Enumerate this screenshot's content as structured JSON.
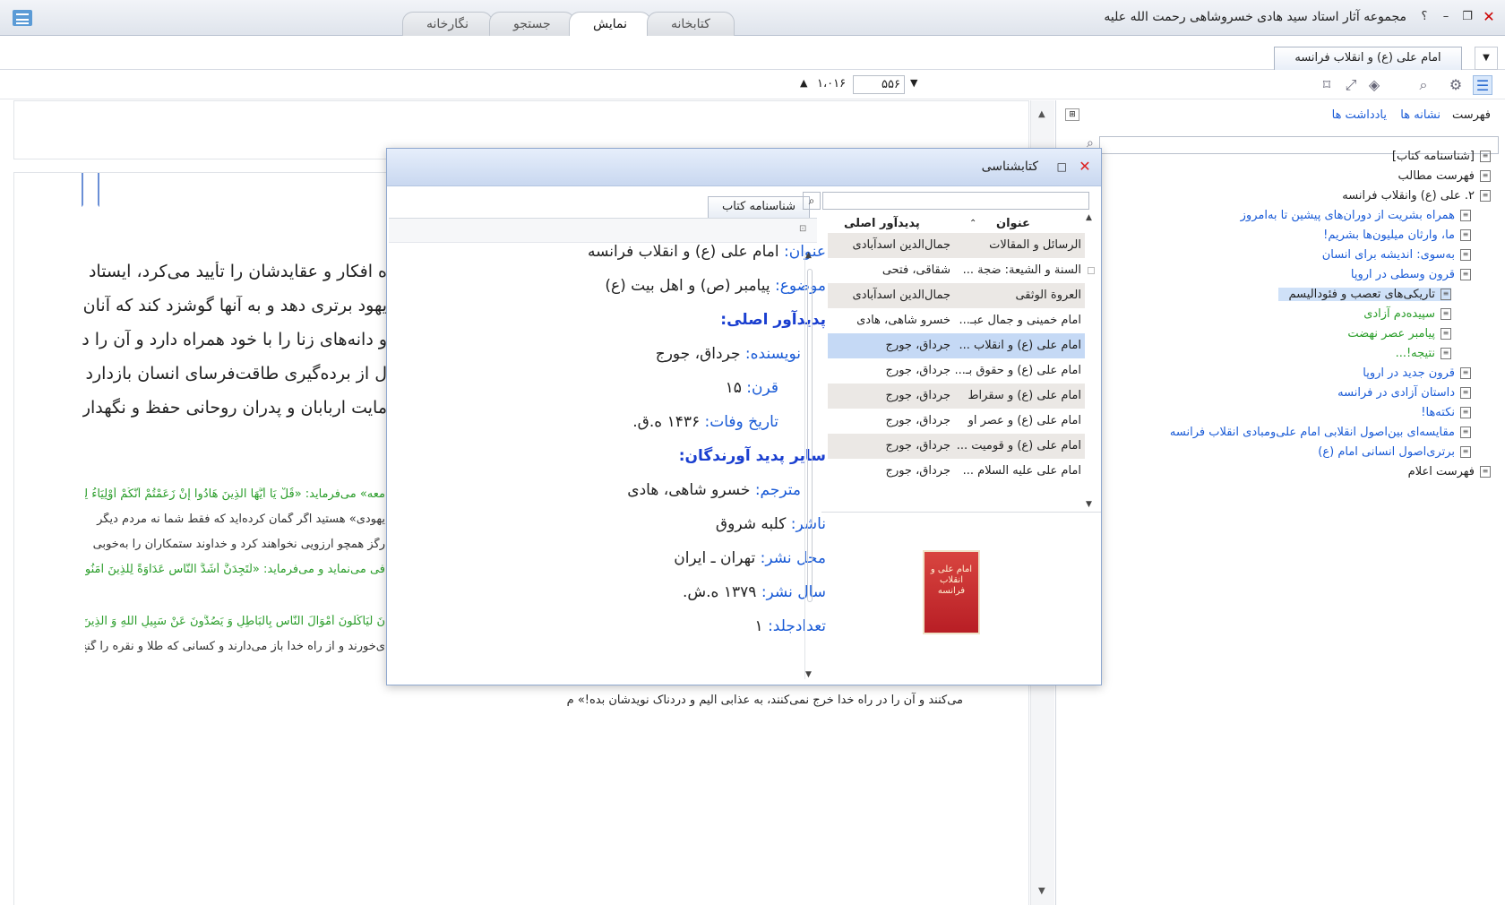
{
  "app": {
    "title": "مجموعه آثار استاد سید هادی خسروشاهی رحمت الله علیه",
    "help": "؟"
  },
  "tabs": [
    "کتابخانه",
    "نمایش",
    "جستجو",
    "نگارخانه"
  ],
  "doc_tab": "امام علی (ع) و انقلاب فرانسه",
  "toolbar": {
    "page": "۵۵۶",
    "total": "۱،۰۱۶"
  },
  "sidebar": {
    "tabs": [
      "فهرست",
      "نشانه ها",
      "یادداشت ها"
    ],
    "items": [
      {
        "label": "[شناسنامه کتاب]",
        "cls": "",
        "indent": 0
      },
      {
        "label": "فهرست مطالب",
        "cls": "",
        "indent": 0
      },
      {
        "label": "۲. علی (ع) وانقلاب فرانسه",
        "cls": "",
        "indent": 0
      },
      {
        "label": "همراه بشریت از دوران‌های پیشین تا به‌امروز",
        "cls": "link",
        "indent": 1
      },
      {
        "label": "ما، وارثان میلیون‌ها بشریم!",
        "cls": "link",
        "indent": 1
      },
      {
        "label": "به‌سوی: اندیشه برای انسان",
        "cls": "link",
        "indent": 1
      },
      {
        "label": "قرون وسطی در اروپا",
        "cls": "link",
        "indent": 1
      },
      {
        "label": "تاریکی‌های تعصب و فئودالیسم",
        "cls": "",
        "indent": 2
      },
      {
        "label": "سپیده‌دم آزادی",
        "cls": "green",
        "indent": 2
      },
      {
        "label": "پیامبر عصر نهضت",
        "cls": "green",
        "indent": 2
      },
      {
        "label": "نتیجه!...",
        "cls": "green",
        "indent": 2
      },
      {
        "label": "قرون جدید در اروپا",
        "cls": "link",
        "indent": 1
      },
      {
        "label": "داستان آزادی در فرانسه",
        "cls": "link",
        "indent": 1
      },
      {
        "label": "نکته‌ها!",
        "cls": "link",
        "indent": 1
      },
      {
        "label": "مقایسه‌ای بین‌اصول انقلابی امام علی‌ومبادی انقلاب فرانسه",
        "cls": "link",
        "indent": 1
      },
      {
        "label": "برتری‌اصول انسانی امام (ع)",
        "cls": "link",
        "indent": 1
      },
      {
        "label": "فهرست اعلام",
        "cls": "",
        "indent": 0
      }
    ]
  },
  "reader": {
    "lines": [
      "ه افکار و عقایدشان را تأیید می‌کرد، ایستاد این",
      "یهود برتری دهد و به آنها گوشزد کند که آنان",
      "و دانه‌های زنا را با خود همراه دارد و آن را در",
      "ل از برده‌گیری طاقت‌فرسای انسان بازدارد و در",
      "مایت اربابان و پدران روحانی حفظ و نگهداری"
    ],
    "footnotes": [
      {
        "t": "معه» می‌فرماید: «قُلْ يَا أَيُّهَا الَّذِينَ هَادُوا إِنْ زَعَمْتُمْ أَنَّكُمْ أَوْلِيَاءُ لِلَّهِ",
        "g": true
      },
      {
        "t": "یهودی» هستید اگر گمان کرده‌اید که فقط شما نه مردم دیگر",
        "g": false
      },
      {
        "t": "رگز همچو آرزویی نخواهند کرد و خداوند ستمکاران را به‌خوبی",
        "g": false
      },
      {
        "t": "فی می‌نماید و می‌فرماید: «لَتَجِدَنَّ أَشَدَّ النَّاسِ عَدَاوَةً لِلَّذِينَ آمَنُوا",
        "g": true
      },
      {
        "t": "نَ لَيَأْكُلُونَ أَمْوَالَ النَّاسِ بِالْبَاطِلِ وَ يَصُدُّونَ عَنْ سَبِيلِ اللَّهِ وَ الَّذِينَ",
        "g": true
      },
      {
        "t": "ی‌خورند و از راه خدا باز می‌دارند و کسانی که طلا و نقره را گنج",
        "g": false
      }
    ],
    "tail": "می‌کنند و آن را در راه خدا خرج نمی‌کنند، به عذابی الیم و دردناک نویدشان بده!» م"
  },
  "dialog": {
    "title": "کتابشناسی",
    "info_tab": "شناسنامه کتاب",
    "fields": [
      {
        "label": "عنوان:",
        "value": "امام علی (ع) و انقلاب فرانسه",
        "kind": "f"
      },
      {
        "label": "موضوع:",
        "value": "پیامبر (ص) و اهل بیت (ع)",
        "kind": "f"
      },
      {
        "label": "پدیدآور اصلی:",
        "value": "",
        "kind": "s"
      },
      {
        "label": "نویسنده:",
        "value": "جرداق، جورج",
        "kind": "i"
      },
      {
        "label": "قرن:",
        "value": "۱۵",
        "kind": "i"
      },
      {
        "label": "تاریخ وفات:",
        "value": "۱۴۳۶ ه.ق.",
        "kind": "i"
      },
      {
        "label": "سایر پدید آورندگان:",
        "value": "",
        "kind": "s"
      },
      {
        "label": "مترجم:",
        "value": "خسرو شاهی، هادی",
        "kind": "i"
      },
      {
        "label": "ناشر:",
        "value": "کلبه شروق",
        "kind": "f"
      },
      {
        "label": "محل نشر:",
        "value": "تهران ـ ایران",
        "kind": "f"
      },
      {
        "label": "سال نشر:",
        "value": "۱۳۷۹ ه.ش.",
        "kind": "f"
      },
      {
        "label": "تعدادجلد:",
        "value": "۱",
        "kind": "f"
      }
    ],
    "columns": [
      "عنوان",
      "پدیدآور اصلی"
    ],
    "rows": [
      [
        "الرسائل و المقالات",
        "جمال‌الدین اسدآبادی"
      ],
      [
        "السنة و الشیعة: ضجة ...",
        "شقاقی، فتحی"
      ],
      [
        "العروة الوثقی",
        "جمال‌الدین اسدآبادی"
      ],
      [
        "امام خمینی و جمال عبـ...",
        "خسرو شاهی، هادی"
      ],
      [
        "امام علی (ع) و انقلاب ...",
        "جرداق، جورج"
      ],
      [
        "امام علی (ع) و حقوق بـ...",
        "جرداق، جورج"
      ],
      [
        "امام علی (ع) و سقراط",
        "جرداق، جورج"
      ],
      [
        "امام علی (ع) و عصر او",
        "جرداق، جورج"
      ],
      [
        "امام علی (ع) و قومیت ...",
        "جرداق، جورج"
      ],
      [
        "امام علی علیه السلام ...",
        "جرداق، جورج"
      ]
    ],
    "selected_row": 4,
    "cover_text": "امام علی و انقلاب فرانسه"
  }
}
